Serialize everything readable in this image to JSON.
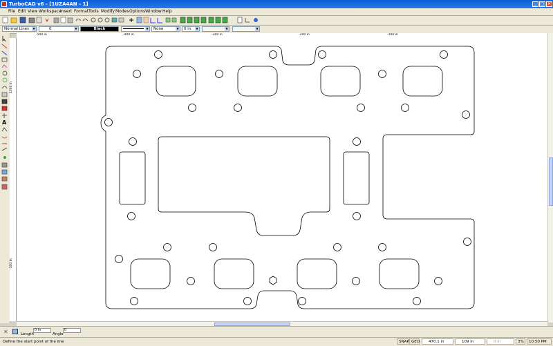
{
  "window": {
    "title": "TurboCAD v6 - [1UZA4AN - 1]"
  },
  "menu": {
    "items": [
      "File",
      "Edit",
      "View",
      "Workspace",
      "Insert",
      "Format",
      "Tools",
      "Modify",
      "Modes",
      "Options",
      "Window",
      "Help"
    ]
  },
  "properties_bar": {
    "line_style": "Normal Lines",
    "line_width": "0",
    "color": "Black",
    "pattern": "None",
    "offset": "0 in"
  },
  "rulers": {
    "horizontal_labels": [
      "-500 in",
      "-400 in",
      "-300 in",
      "-200 in",
      "-100 in"
    ],
    "vertical_labels": [
      "1000 in",
      "-100 in"
    ]
  },
  "inspector": {
    "length_label": "Length",
    "length_value": "0 in",
    "angle_label": "Angle",
    "angle_value": "0"
  },
  "status": {
    "prompt": "Define the start point of the line",
    "snap": "SNAP",
    "geo": "GEO",
    "x_coord": "470.1 in",
    "y_coord": "109 in",
    "z_coord": "0 in",
    "zoom": "3%",
    "clock": "10:50 PM"
  },
  "colors": {
    "title_blue": "#0a5fd8",
    "chrome": "#ece9d8",
    "drawing_line": "#000000"
  }
}
